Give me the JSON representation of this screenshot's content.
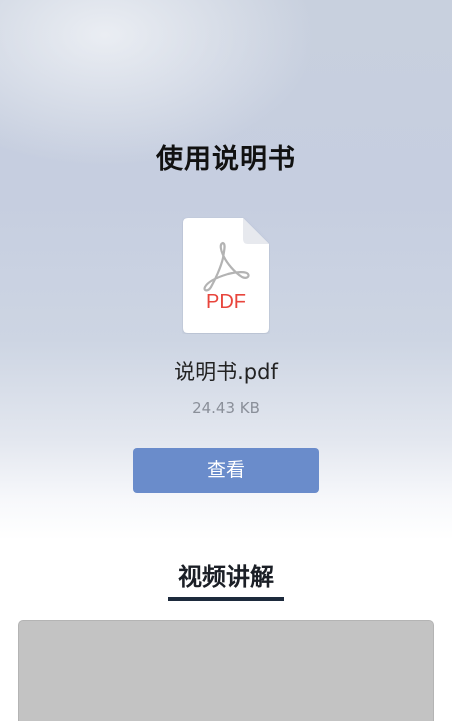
{
  "page": {
    "title": "使用说明书"
  },
  "document": {
    "icon": "pdf-file-icon",
    "icon_label": "PDF",
    "file_name": "说明书.pdf",
    "file_size": "24.43 KB",
    "view_label": "查看",
    "accent_color": "#6a8ccb",
    "pdf_color": "#e8453c"
  },
  "video_section": {
    "title": "视频讲解"
  }
}
